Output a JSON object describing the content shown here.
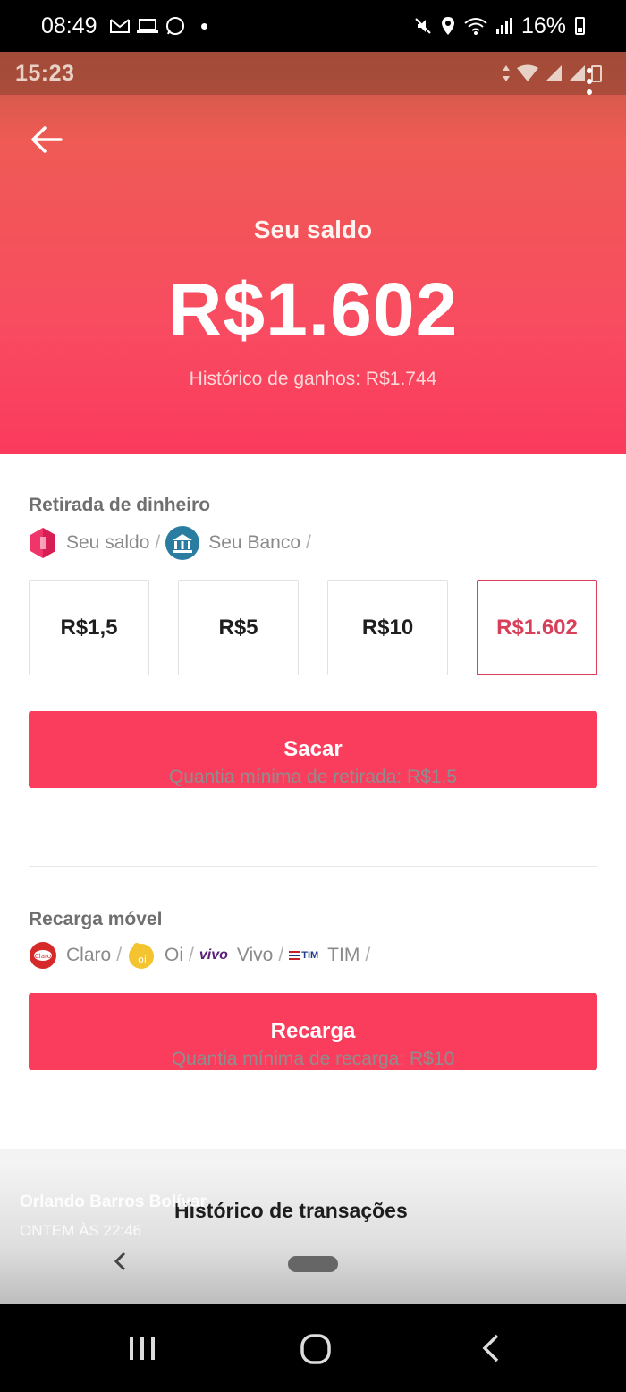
{
  "outer_status": {
    "time": "08:49",
    "battery": "16%"
  },
  "inner_status": {
    "time": "15:23"
  },
  "balance": {
    "label": "Seu saldo",
    "value": "R$1.602",
    "earnings": "Histórico de ganhos: R$1.744"
  },
  "withdraw": {
    "title": "Retirada de dinheiro",
    "methods": [
      "Seu saldo",
      "Seu Banco"
    ],
    "amounts": [
      "R$1,5",
      "R$5",
      "R$10",
      "R$1.602"
    ],
    "selected_index": 3,
    "button": "Sacar",
    "minimum": "Quantia mínima de retirada: R$1.5"
  },
  "recharge": {
    "title": "Recarga móvel",
    "carriers": [
      "Claro",
      "Oi",
      "Vivo",
      "TIM"
    ],
    "vivo_logo_text": "vivo",
    "tim_logo_text": "TIM",
    "button": "Recarga",
    "minimum": "Quantia mínima de recarga: R$10"
  },
  "history": {
    "title": "Histórico de transações"
  },
  "overlay": {
    "name": "Orlando Barros Bolívar",
    "time": "ONTEM ÀS 22:46"
  },
  "colors": {
    "accent": "#fb3d5d",
    "selected_border": "#d8405a"
  },
  "icons": {
    "back": "arrow-left-icon",
    "menu": "kebab-menu-icon",
    "balance_method": "gem-icon",
    "bank_method": "bank-icon"
  }
}
